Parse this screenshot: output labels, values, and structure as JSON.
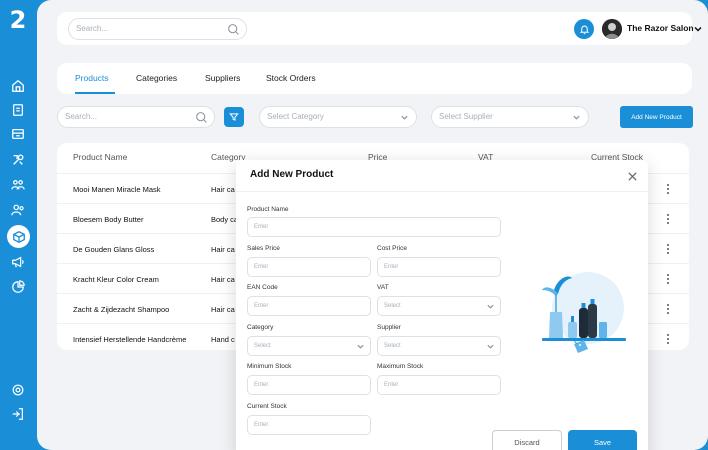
{
  "app": {
    "logo_text": "2"
  },
  "topbar": {
    "search_placeholder": "Search...",
    "user_name": "The Razor Salon"
  },
  "tabs": [
    {
      "label": "Products",
      "active": true
    },
    {
      "label": "Categories",
      "active": false
    },
    {
      "label": "Suppliers",
      "active": false
    },
    {
      "label": "Stock Orders",
      "active": false
    }
  ],
  "toolbar": {
    "search_placeholder": "Search...",
    "category_select": "Select Category",
    "supplier_select": "Select Supplier",
    "add_button": "Add New Product"
  },
  "table": {
    "headers": [
      "Product Name",
      "Category",
      "Price",
      "VAT",
      "Current Stock"
    ],
    "rows": [
      {
        "name": "Mooi Manen Miracle Mask",
        "category": "Hair ca"
      },
      {
        "name": "Bloesem Body Butter",
        "category": "Body ca"
      },
      {
        "name": "De Gouden Glans Gloss",
        "category": "Hair ca"
      },
      {
        "name": "Kracht Kleur Color Cream",
        "category": "Hair ca"
      },
      {
        "name": "Zacht & Zijdezacht Shampoo",
        "category": "Hair ca"
      },
      {
        "name": "Intensief Herstellende Handcrème",
        "category": "Hand c"
      }
    ]
  },
  "modal": {
    "title": "Add New Product",
    "fields": {
      "product_name": {
        "label": "Product Name",
        "placeholder": "Enter"
      },
      "sales_price": {
        "label": "Sales Price",
        "placeholder": "Enter"
      },
      "cost_price": {
        "label": "Cost Price",
        "placeholder": "Enter"
      },
      "ean_code": {
        "label": "EAN Code",
        "placeholder": "Enter"
      },
      "vat": {
        "label": "VAT",
        "placeholder": "Select"
      },
      "category": {
        "label": "Category",
        "placeholder": "Select"
      },
      "supplier": {
        "label": "Supplier",
        "placeholder": "Select"
      },
      "minimum_stock": {
        "label": "Minimum Stock",
        "placeholder": "Enter"
      },
      "maximum_stock": {
        "label": "Maximum Stock",
        "placeholder": "Enter"
      },
      "current_stock": {
        "label": "Current Stock",
        "placeholder": "Enter"
      }
    },
    "discard_label": "Discard",
    "save_label": "Save"
  },
  "colors": {
    "accent": "#1a8fd8",
    "background": "#f1f3f6",
    "surface": "#ffffff"
  },
  "icons": {
    "sidebar": [
      "home-icon",
      "book-icon",
      "inbox-icon",
      "tools-icon",
      "team-icon",
      "clients-icon",
      "box-icon",
      "megaphone-icon",
      "pie-chart-icon",
      "settings-icon",
      "logout-icon"
    ]
  }
}
